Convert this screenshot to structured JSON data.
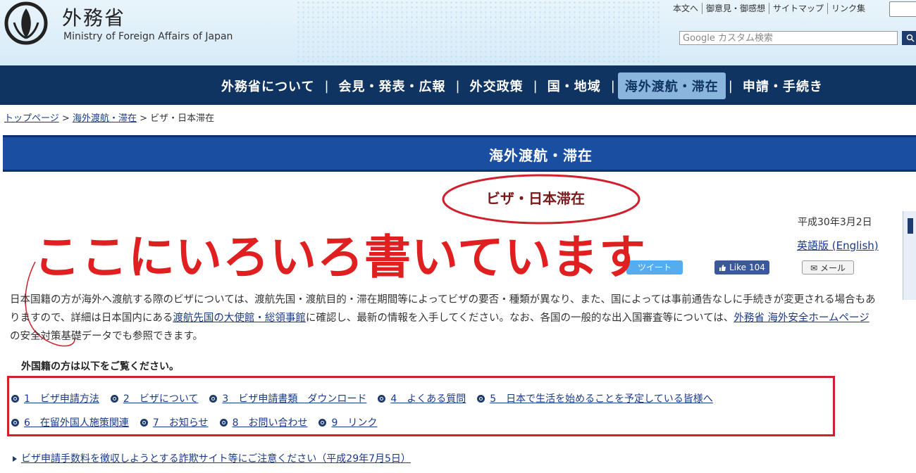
{
  "header": {
    "title": "外務省",
    "subtitle": "Ministry of Foreign Affairs of Japan",
    "util_links": [
      "本文へ",
      "御意見・御感想",
      "サイトマップ",
      "リンク集"
    ],
    "search_placeholder": "Google カスタム検索"
  },
  "gnav": [
    "外務省について",
    "会見・発表・広報",
    "外交政策",
    "国・地域",
    "海外渡航・滞在",
    "申請・手続き"
  ],
  "breadcrumb": {
    "home": "トップページ",
    "section": "海外渡航・滞在",
    "sep": ">",
    "current": "ビザ・日本滞在"
  },
  "banner": "海外渡航・滞在",
  "page_title": "ビザ・日本滞在",
  "date": "平成30年3月2日",
  "english_link": "英語版 (English)",
  "annotation": "ここにいろいろ書いています",
  "social": {
    "tweet": "ツイート",
    "like": "Like",
    "like_count": "104",
    "mail": "メール"
  },
  "intro": {
    "p1": "日本国籍の方が海外へ渡航する際のビザについては、渡航先国・渡航目的・滞在期間等によってビザの要否・種類が異なり、また、国によっては事前通告なしに手続きが変更される場合もありますので、詳細は日本国内にある",
    "link1": "渡航先国の大使館・総領事館",
    "p2": "に確認し、最新の情報を入手してください。なお、各国の一般的な出入国審査等については、",
    "link2": "外務省 海外安全ホームページ",
    "p3": "の安全対策基礎データでも参照できます。"
  },
  "subhead": "外国籍の方は以下をご覧ください。",
  "links_row1": [
    "1　ビザ申請方法",
    "2　ビザについて",
    "3　ビザ申請書類　ダウンロード",
    "4　よくある質問",
    "5　日本で生活を始めることを予定している皆様へ"
  ],
  "links_row2": [
    "6　在留外国人施策関連",
    "7　お知らせ",
    "8　お問い合わせ",
    "9　リンク"
  ],
  "notice": "ビザ申請手数料を徴収しようとする詐欺サイト等にご注意ください（平成29年7月5日）"
}
